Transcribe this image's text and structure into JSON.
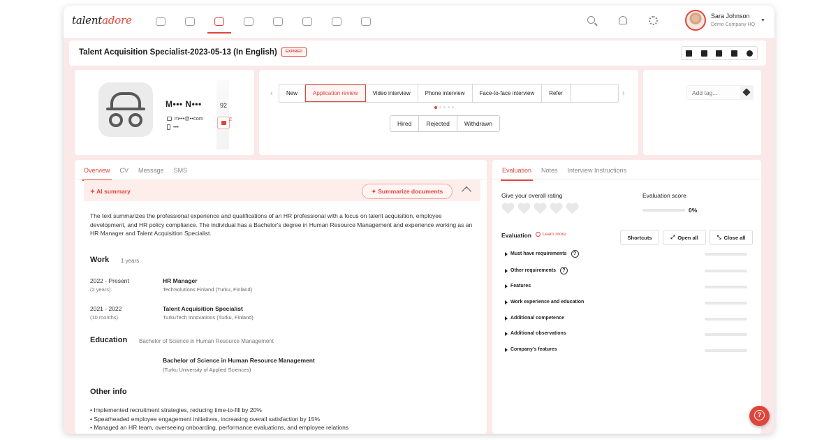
{
  "brand": {
    "logo_prefix": "talent",
    "logo_accent": "adore",
    "accent_color": "#e0453b"
  },
  "nav": {
    "icons": [
      "home-icon",
      "briefcase-icon",
      "candidates-icon",
      "calendar-icon",
      "chart-icon",
      "diamond-icon",
      "badge-icon",
      "network-icon"
    ],
    "active_index": 2
  },
  "user": {
    "name": "Sara Johnson",
    "company": "Demo Company HQ"
  },
  "page": {
    "title": "Talent Acquisition Specialist-2023-05-13 (In English)",
    "status_badge": "EXPIRED"
  },
  "candidate": {
    "name": "M••• N•••",
    "email": "m•••@••com",
    "phone": "•••",
    "score": "92",
    "badge_count": "2"
  },
  "pipeline": {
    "stages": [
      "New",
      "Application review",
      "Video interview",
      "Phone interview",
      "Face-to-face interview",
      "Refer"
    ],
    "active_stage": 1,
    "outcomes": [
      "Hired",
      "Rejected",
      "Withdrawn"
    ]
  },
  "tags": {
    "placeholder": "Add tag..."
  },
  "left_tabs": [
    "Overview",
    "CV",
    "Message",
    "SMS"
  ],
  "ai": {
    "label": "AI summary",
    "button": "Summarize documents",
    "summary": "The text summarizes the professional experience and qualifications of an HR professional with a focus on talent acquisition, employee development, and HR policy compliance. The individual has a Bachelor's degree in Human Resource Management and experience working as an HR Manager and Talent Acquisition Specialist."
  },
  "work": {
    "title": "Work",
    "years": "1 years",
    "items": [
      {
        "period": "2022 - Present",
        "duration": "(2 years)",
        "role": "HR Manager",
        "org": "TechSolutions Finland (Turku, Finland)"
      },
      {
        "period": "2021 - 2022",
        "duration": "(10 months)",
        "role": "Talent Acquisition Specialist",
        "org": "TurkuTech Innovations (Turku, Finland)"
      }
    ]
  },
  "education": {
    "title": "Education",
    "summary": "Bachelor of Science in Human Resource Management",
    "degree": "Bachelor of Science in Human Resource Management",
    "school": "(Turku University of Applied Sciences)"
  },
  "other": {
    "title": "Other info",
    "bullets": [
      "Implemented recruitment strategies, reducing time-to-fill by 20%",
      "Spearheaded employee engagement initiatives, increasing overall satisfaction by 15%",
      "Managed an HR team, overseeing onboarding, performance evaluations, and employee relations"
    ]
  },
  "right_tabs": [
    "Evaluation",
    "Notes",
    "Interview Instructions"
  ],
  "evaluation": {
    "rating_label": "Give your overall rating",
    "rating_value": 0,
    "rating_max": 5,
    "score_label": "Evaluation score",
    "score_value": "0%",
    "section_label": "Evaluation",
    "learn_more": "Learn more",
    "buttons": [
      "Shortcuts",
      "Open all",
      "Close all"
    ],
    "criteria": [
      "Must have requirements",
      "Other requirements",
      "Features",
      "Work experience and education",
      "Additional competence",
      "Additional observations",
      "Company's features"
    ]
  }
}
